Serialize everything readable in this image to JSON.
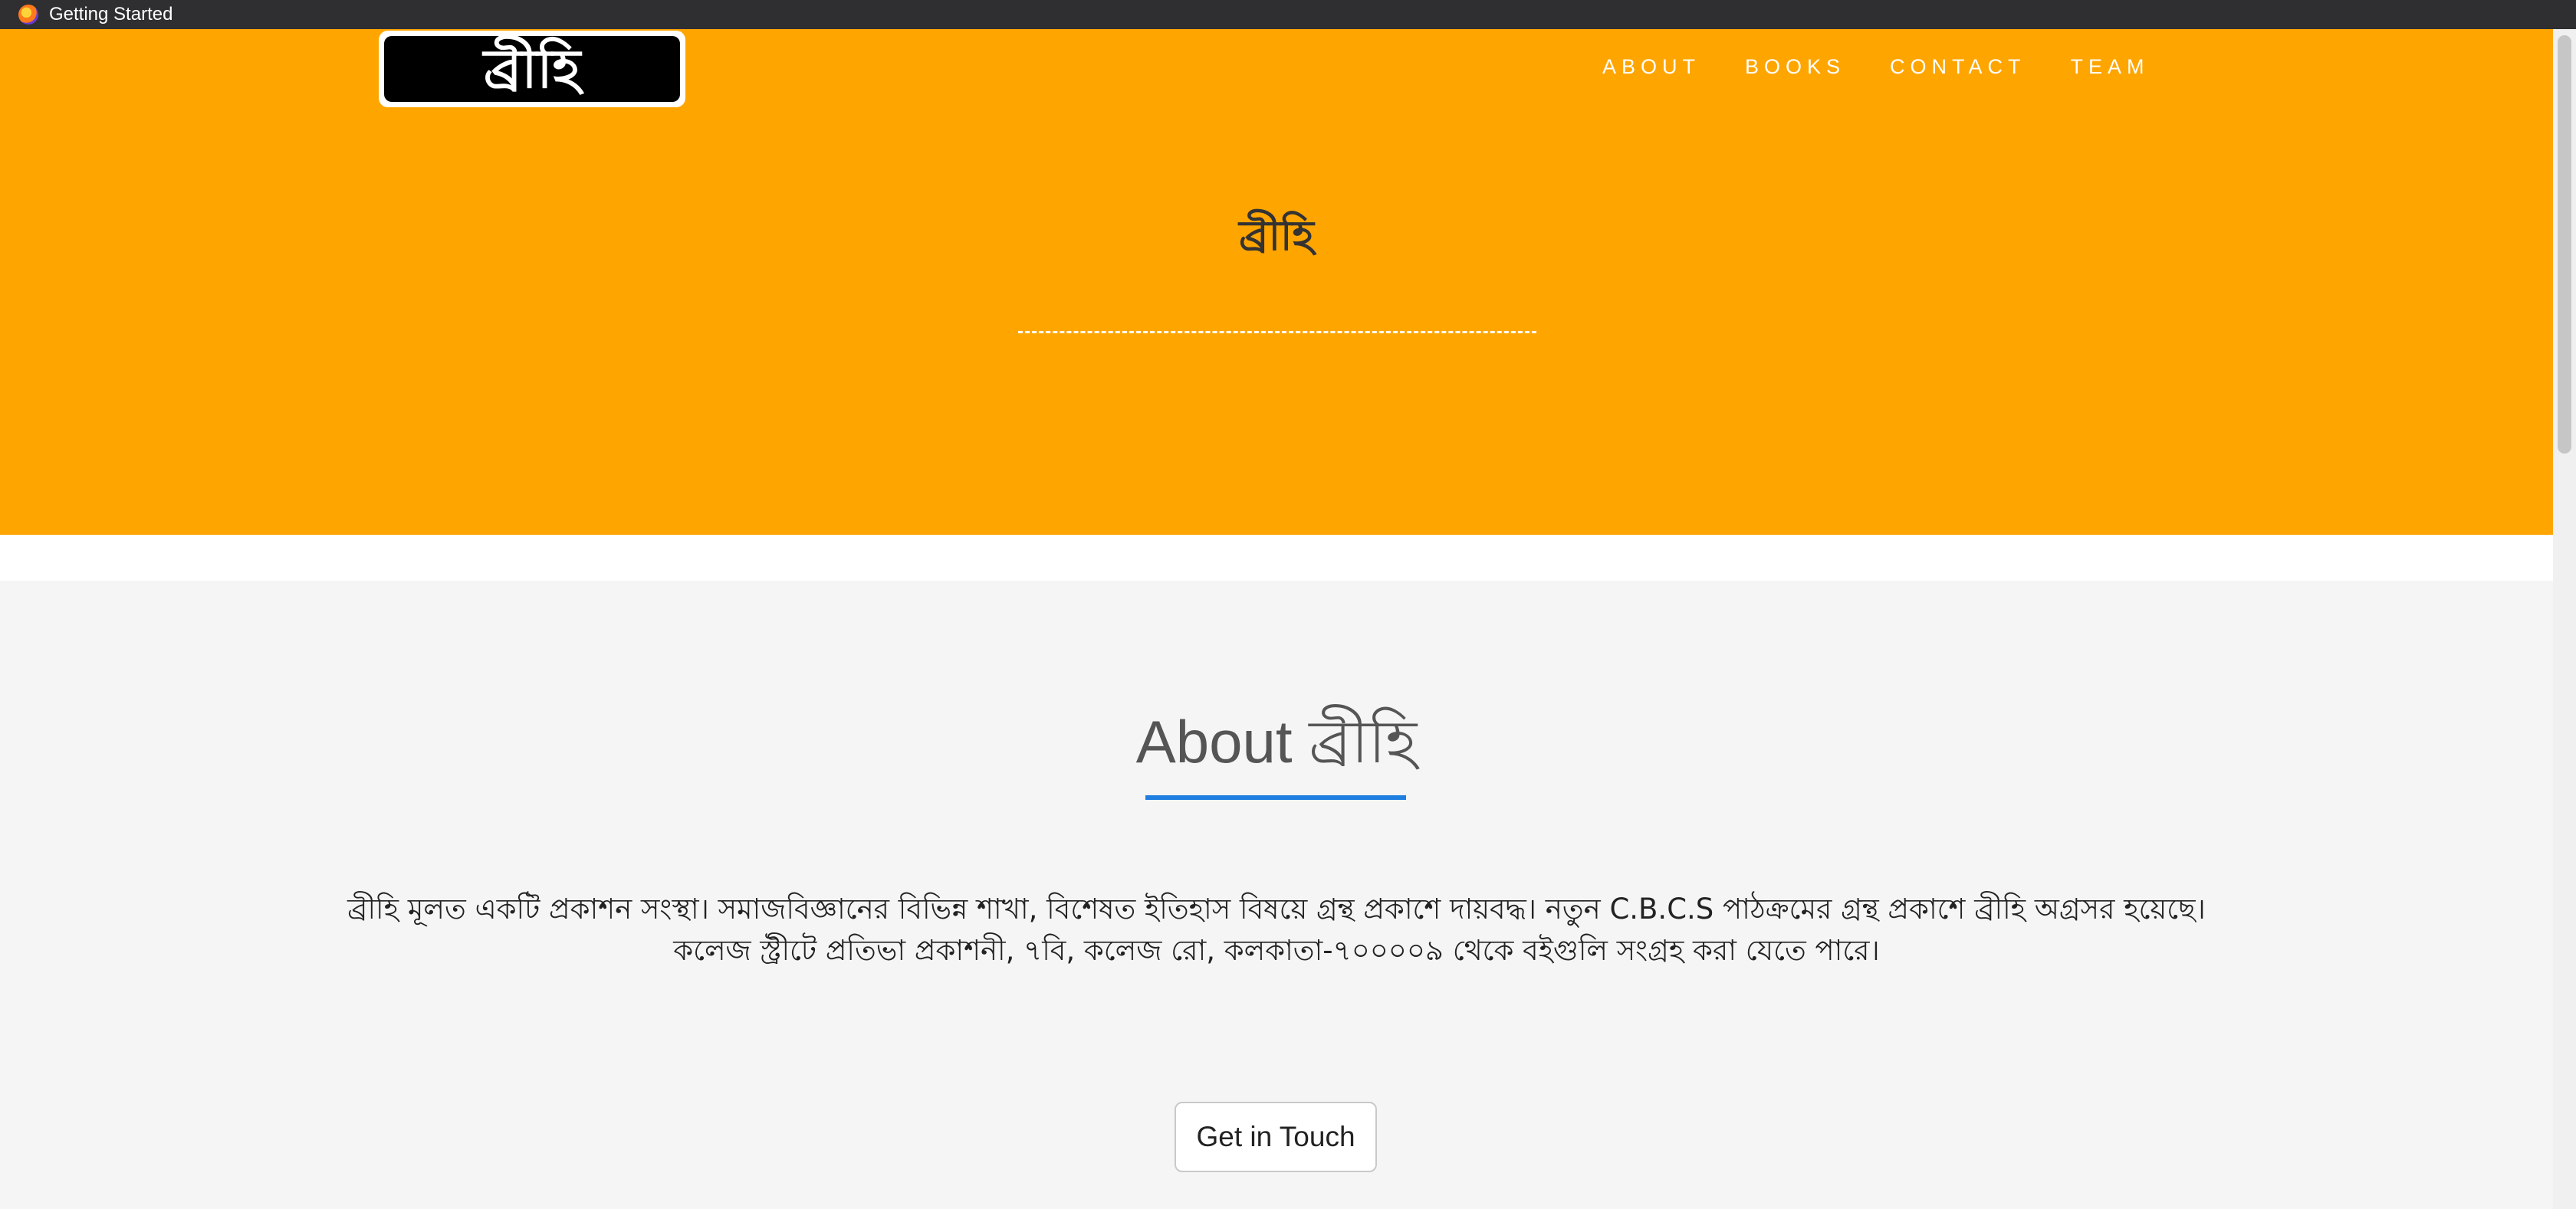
{
  "browser": {
    "tab_title": "Getting Started"
  },
  "header": {
    "logo_text": "ব্রীহি",
    "nav": [
      {
        "label": "ABOUT"
      },
      {
        "label": "BOOKS"
      },
      {
        "label": "CONTACT"
      },
      {
        "label": "TEAM"
      }
    ]
  },
  "hero": {
    "title": "ব্রীহি",
    "divider": "------------------------------------------"
  },
  "about": {
    "title": "About ব্রীহি",
    "body_line1": "ব্রীহি মূলত একটি প্রকাশন সংস্থা। সমাজবিজ্ঞানের বিভিন্ন শাখা, বিশেষত ইতিহাস বিষয়ে গ্রন্থ প্রকাশে দায়বদ্ধ। নতুন C.B.C.S পাঠক্রমের গ্রন্থ প্রকাশে ব্রীহি অগ্রসর হয়েছে।",
    "body_line2": "কলেজ স্ট্রীটে প্রতিভা প্রকাশনী, ৭বি, কলেজ রো, কলকাতা-৭০০০০৯ থেকে বইগুলি সংগ্রহ করা যেতে পারে।",
    "cta_label": "Get in Touch"
  },
  "colors": {
    "hero_bg": "#ffa500",
    "accent_underline": "#1e7fe1",
    "page_bg": "#f5f5f5"
  }
}
